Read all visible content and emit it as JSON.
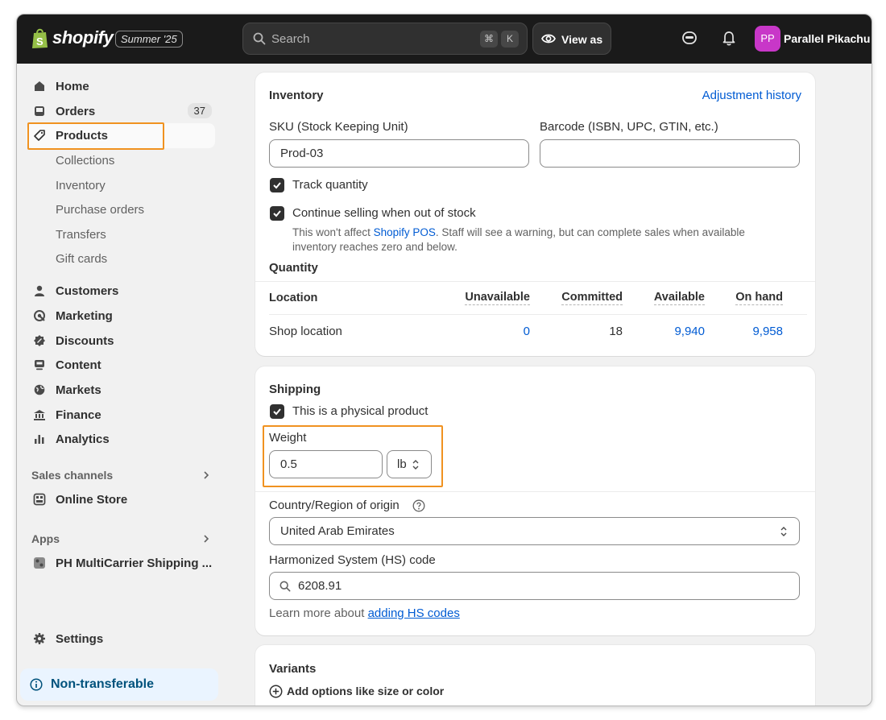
{
  "brand": {
    "name": "shopify",
    "edition": "Summer '25"
  },
  "search": {
    "placeholder": "Search",
    "key1": "⌘",
    "key2": "K"
  },
  "header": {
    "view_as": "View as",
    "avatar_initials": "PP",
    "user_name": "Parallel Pikachu"
  },
  "sidebar": {
    "home": "Home",
    "orders": "Orders",
    "orders_count": "37",
    "products": "Products",
    "collections": "Collections",
    "inventory": "Inventory",
    "purchase_orders": "Purchase orders",
    "transfers": "Transfers",
    "gift_cards": "Gift cards",
    "customers": "Customers",
    "marketing": "Marketing",
    "discounts": "Discounts",
    "content": "Content",
    "markets": "Markets",
    "finance": "Finance",
    "analytics": "Analytics",
    "sales_channels": "Sales channels",
    "online_store": "Online Store",
    "apps": "Apps",
    "app_item": "PH MultiCarrier Shipping ...",
    "settings": "Settings",
    "non_transferable": "Non-transferable"
  },
  "inventory": {
    "title": "Inventory",
    "adjustment_history": "Adjustment history",
    "sku_label": "SKU (Stock Keeping Unit)",
    "sku_value": "Prod-03",
    "barcode_label": "Barcode (ISBN, UPC, GTIN, etc.)",
    "barcode_value": "",
    "track_quantity": "Track quantity",
    "continue_selling": "Continue selling when out of stock",
    "help_prefix": "This won't affect ",
    "help_link": "Shopify POS",
    "help_suffix": ". Staff will see a warning, but can complete sales when available inventory reaches zero and below.",
    "quantity_title": "Quantity",
    "columns": [
      "Location",
      "Unavailable",
      "Committed",
      "Available",
      "On hand"
    ],
    "row": {
      "location": "Shop location",
      "unavailable": "0",
      "committed": "18",
      "available": "9,940",
      "on_hand": "9,958"
    }
  },
  "shipping": {
    "title": "Shipping",
    "physical_product": "This is a physical product",
    "weight_label": "Weight",
    "weight_value": "0.5",
    "weight_unit": "lb",
    "country_label": "Country/Region of origin",
    "country_value": "United Arab Emirates",
    "hs_label": "Harmonized System (HS) code",
    "hs_value": "6208.91",
    "learn_prefix": "Learn more about ",
    "learn_link": "adding HS codes"
  },
  "variants": {
    "title": "Variants",
    "add_options": "Add options like size or color"
  },
  "colors": {
    "topbar": "#1a1a1a",
    "highlight": "#f09220",
    "link": "#005bd3",
    "avatar": "#c837c8"
  }
}
